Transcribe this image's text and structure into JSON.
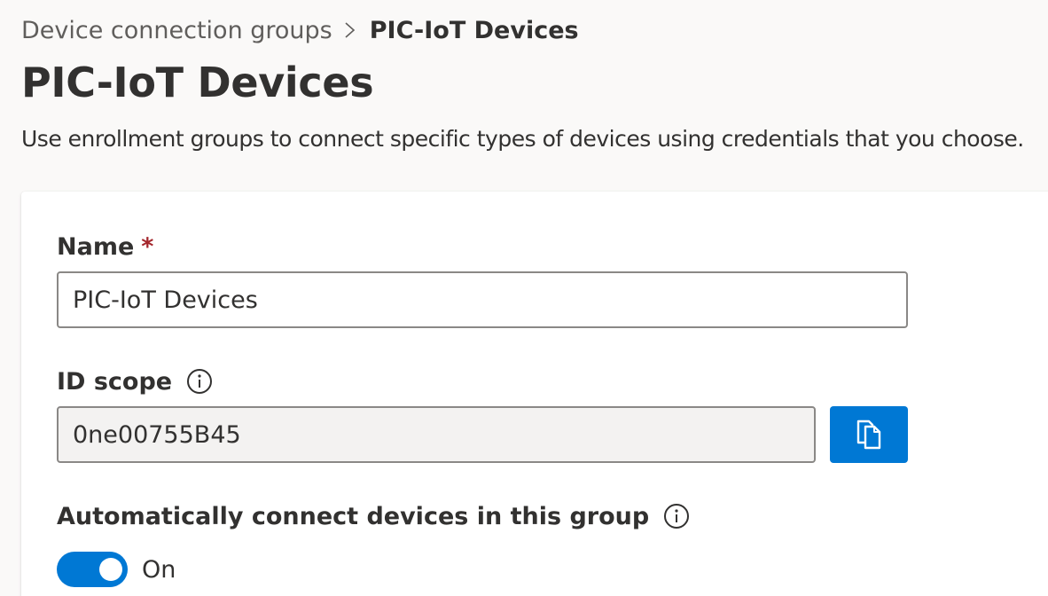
{
  "breadcrumb": {
    "parent": "Device connection groups",
    "current": "PIC-IoT Devices"
  },
  "page": {
    "title": "PIC-IoT Devices",
    "description": "Use enrollment groups to connect specific types of devices using credentials that you choose."
  },
  "form": {
    "name": {
      "label": "Name",
      "required_mark": "*",
      "value": "PIC-IoT Devices"
    },
    "id_scope": {
      "label": "ID scope",
      "value": "0ne00755B45",
      "info_icon": "info-icon",
      "copy_icon": "copy-icon"
    },
    "auto_connect": {
      "label": "Automatically connect devices in this group",
      "info_icon": "info-icon",
      "toggle_state": "On",
      "enabled": true
    }
  },
  "colors": {
    "accent": "#0078d4",
    "required": "#a4262c",
    "text": "#323130",
    "muted": "#605e5c",
    "background": "#faf9f8"
  }
}
